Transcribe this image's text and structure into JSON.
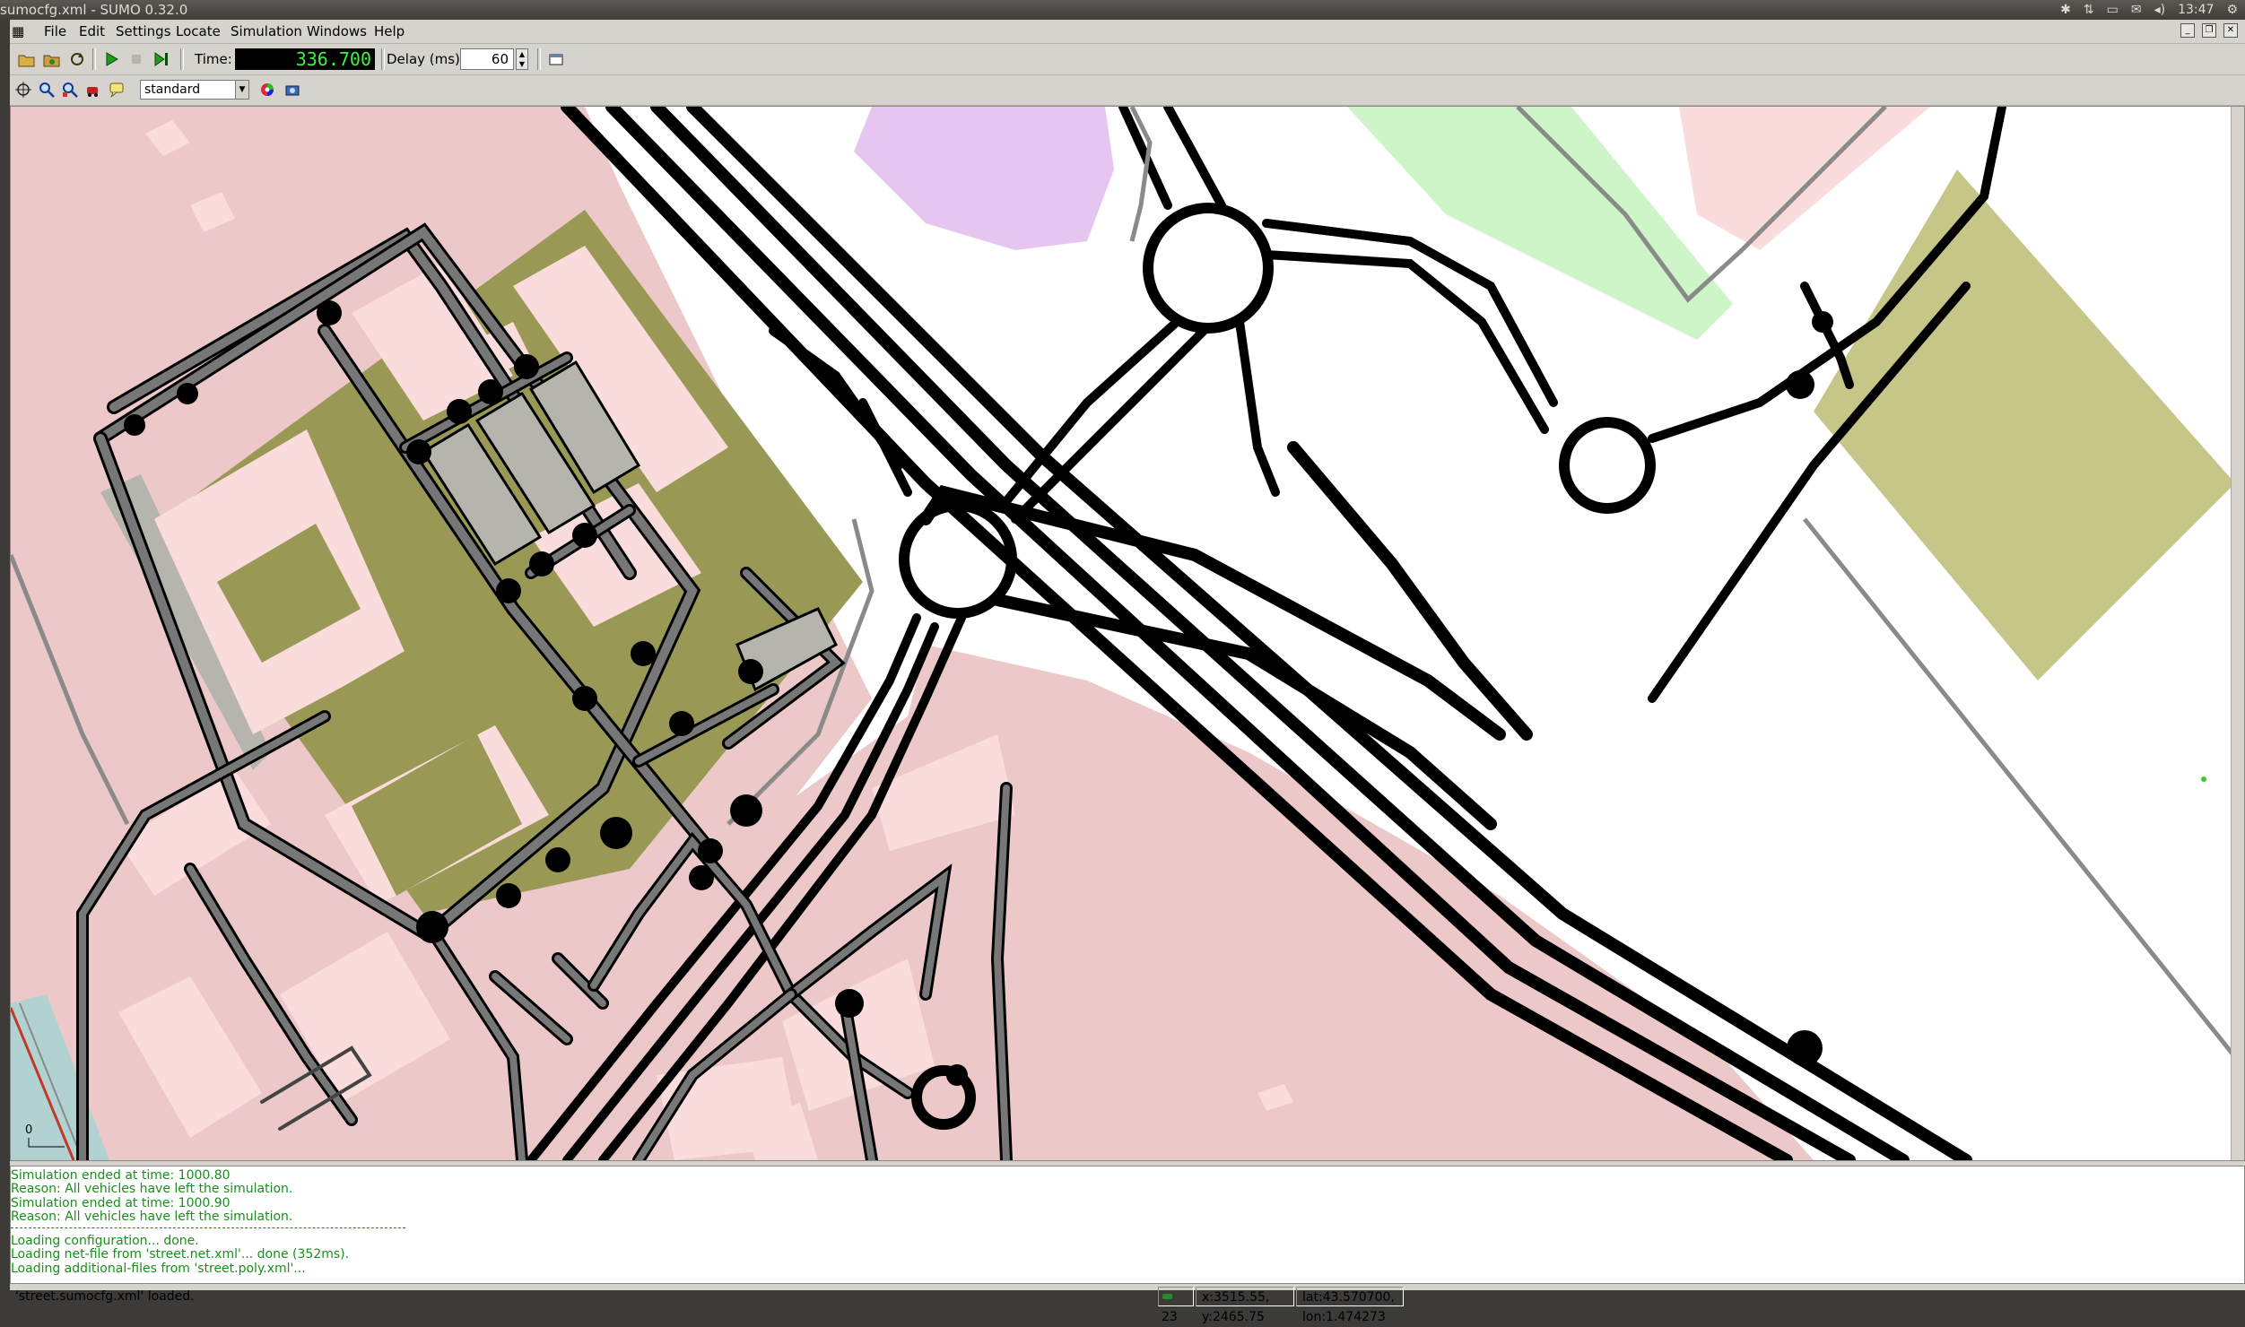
{
  "window": {
    "title": "sumocfg.xml - SUMO 0.32.0",
    "clock": "13:47"
  },
  "menu": [
    "File",
    "Edit",
    "Settings",
    "Locate",
    "Simulation",
    "Windows",
    "Help"
  ],
  "toolbar": {
    "time_label": "Time:",
    "time_value": "336.700",
    "delay_label": "Delay (ms):",
    "delay_value": "60"
  },
  "view_toolbar": {
    "scheme_value": "standard"
  },
  "map": {
    "scale_label": "0",
    "colors": {
      "residential": "#ecc8c8",
      "building": "#fadcdc",
      "parking": "#999955",
      "park": "#cdf5c8",
      "commercial": "#e6c6f0",
      "field": "#c6c689",
      "water": "#b2d2d2",
      "road": "#000000"
    }
  },
  "messages": [
    {
      "text": "Simulation ended at time: 1000.80",
      "kind": "g"
    },
    {
      "text": "Reason: All vehicles have left the simulation.",
      "kind": "g"
    },
    {
      "text": "Simulation ended at time: 1000.90",
      "kind": "g"
    },
    {
      "text": "Reason: All vehicles have left the simulation.",
      "kind": "g"
    },
    {
      "text": "Loading configuration... done.",
      "kind": "g"
    },
    {
      "text": "Loading net-file from 'street.net.xml'... done (352ms).",
      "kind": "g"
    },
    {
      "text": "Loading additional-files from 'street.poly.xml'...",
      "kind": "g"
    }
  ],
  "status": {
    "main": "'street.sumocfg.xml' loaded.",
    "vehicles": "23",
    "coords": "x:3515.55, y:2465.75",
    "geo": "lat:43.570700, lon:1.474273"
  }
}
